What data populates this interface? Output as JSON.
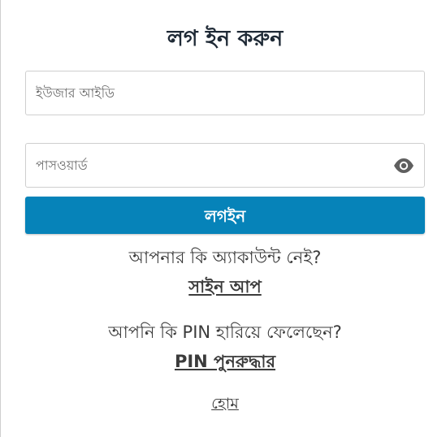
{
  "login": {
    "title": "লগ ইন করুন",
    "user_id_placeholder": "ইউজার আইডি",
    "password_placeholder": "পাসওয়ার্ড",
    "password_toggle_icon": "eye-icon",
    "login_button": "লগইন",
    "accent_color": "#0683b9"
  },
  "links": {
    "no_account_text": "আপনার কি অ্যাকাউন্ট নেই?",
    "signup_label": "সাইন আপ",
    "lost_pin_text": "আপনি কি PIN হারিয়ে ফেলেছেন?",
    "pin_recovery_label": "PIN পুনরুদ্ধার",
    "home_label": "হোম"
  }
}
